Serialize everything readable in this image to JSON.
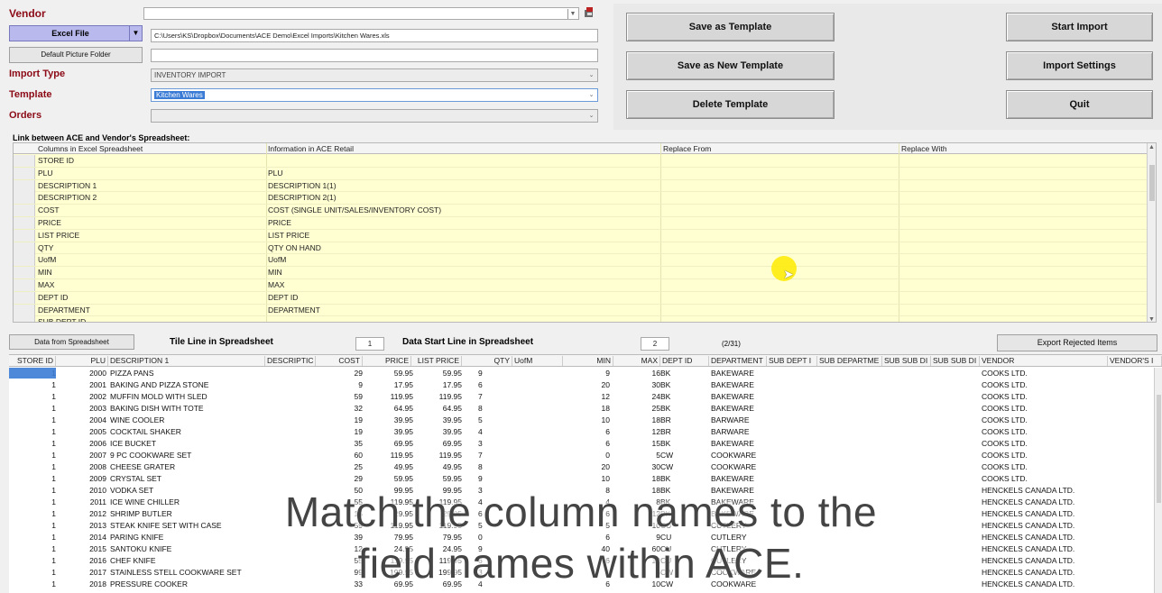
{
  "labels": {
    "vendor": "Vendor",
    "import_type": "Import Type",
    "template": "Template",
    "orders": "Orders"
  },
  "controls": {
    "excel_file": "Excel File",
    "default_picture_folder": "Default Picture Folder",
    "file_path": "C:\\Users\\KS\\Dropbox\\Documents\\ACE Demo\\Excel Imports\\Kitchen Wares.xls",
    "import_type_value": "INVENTORY IMPORT",
    "template_value": "Kitchen Wares"
  },
  "buttons": {
    "save_template": "Save as Template",
    "save_new_template": "Save as New Template",
    "delete_template": "Delete Template",
    "start_import": "Start Import",
    "import_settings": "Import Settings",
    "quit": "Quit",
    "data_from_spreadsheet": "Data from Spreadsheet",
    "export_rejected": "Export Rejected Items"
  },
  "link": {
    "title": "Link between ACE and Vendor's Spreadsheet:",
    "headers": [
      "Columns in Excel Spreadsheet",
      "Information in ACE Retail",
      "Replace From",
      "Replace With"
    ],
    "rows": [
      [
        "STORE ID",
        ""
      ],
      [
        "PLU",
        "PLU"
      ],
      [
        "DESCRIPTION 1",
        "DESCRIPTION 1(1)"
      ],
      [
        "DESCRIPTION 2",
        "DESCRIPTION 2(1)"
      ],
      [
        "COST",
        "COST (SINGLE UNIT/SALES/INVENTORY COST)"
      ],
      [
        "PRICE",
        "PRICE"
      ],
      [
        "LIST PRICE",
        "LIST PRICE"
      ],
      [
        "QTY",
        "QTY ON HAND"
      ],
      [
        "UofM",
        "UofM"
      ],
      [
        "MIN",
        "MIN"
      ],
      [
        "MAX",
        "MAX"
      ],
      [
        "DEPT ID",
        "DEPT ID"
      ],
      [
        "DEPARTMENT",
        "DEPARTMENT"
      ],
      [
        "SUB DEPT ID",
        ""
      ]
    ]
  },
  "lines": {
    "title_line_label": "Tile Line in Spreadsheet",
    "title_line_value": "1",
    "data_start_label": "Data Start Line in Spreadsheet",
    "data_start_value": "2",
    "counter": "(2/31)"
  },
  "grid": {
    "headers": [
      "STORE ID",
      "PLU",
      "DESCRIPTION 1",
      "DESCRIPTIC",
      "COST",
      "PRICE",
      "LIST PRICE",
      "QTY",
      "UofM",
      "MIN",
      "MAX",
      "DEPT ID",
      "DEPARTMENT",
      "SUB DEPT I",
      "SUB DEPARTME",
      "SUB SUB DI",
      "SUB SUB DI",
      "VENDOR",
      "VENDOR'S I"
    ],
    "rows": [
      [
        "1",
        "2000",
        "PIZZA PANS",
        "29",
        "59.95",
        "59.95",
        "9",
        "9",
        "16",
        "BK",
        "BAKEWARE",
        "COOKS LTD."
      ],
      [
        "1",
        "2001",
        "BAKING AND PIZZA STONE",
        "9",
        "17.95",
        "17.95",
        "6",
        "20",
        "30",
        "BK",
        "BAKEWARE",
        "COOKS LTD."
      ],
      [
        "1",
        "2002",
        "MUFFIN MOLD WITH SLED",
        "59",
        "119.95",
        "119.95",
        "7",
        "12",
        "24",
        "BK",
        "BAKEWARE",
        "COOKS LTD."
      ],
      [
        "1",
        "2003",
        "BAKING DISH WITH TOTE",
        "32",
        "64.95",
        "64.95",
        "8",
        "18",
        "25",
        "BK",
        "BAKEWARE",
        "COOKS LTD."
      ],
      [
        "1",
        "2004",
        "WINE COOLER",
        "19",
        "39.95",
        "39.95",
        "5",
        "10",
        "18",
        "BR",
        "BARWARE",
        "COOKS LTD."
      ],
      [
        "1",
        "2005",
        "COCKTAIL SHAKER",
        "19",
        "39.95",
        "39.95",
        "4",
        "6",
        "12",
        "BR",
        "BARWARE",
        "COOKS LTD."
      ],
      [
        "1",
        "2006",
        "ICE BUCKET",
        "35",
        "69.95",
        "69.95",
        "3",
        "6",
        "15",
        "BK",
        "BAKEWARE",
        "COOKS LTD."
      ],
      [
        "1",
        "2007",
        "9 PC COOKWARE SET",
        "60",
        "119.95",
        "119.95",
        "7",
        "0",
        "5",
        "CW",
        "COOKWARE",
        "COOKS LTD."
      ],
      [
        "1",
        "2008",
        "CHEESE GRATER",
        "25",
        "49.95",
        "49.95",
        "8",
        "20",
        "30",
        "CW",
        "COOKWARE",
        "COOKS LTD."
      ],
      [
        "1",
        "2009",
        "CRYSTAL SET",
        "29",
        "59.95",
        "59.95",
        "9",
        "10",
        "18",
        "BK",
        "BAKEWARE",
        "COOKS LTD."
      ],
      [
        "1",
        "2010",
        "VODKA SET",
        "50",
        "99.95",
        "99.95",
        "3",
        "8",
        "18",
        "BK",
        "BAKEWARE",
        "HENCKELS CANADA LTD."
      ],
      [
        "1",
        "2011",
        "ICE WINE CHILLER",
        "55",
        "119.95",
        "119.95",
        "4",
        "4",
        "8",
        "BK",
        "BAKEWARE",
        "HENCKELS CANADA LTD."
      ],
      [
        "1",
        "2012",
        "SHRIMP BUTLER",
        "15",
        "29.95",
        "29.95",
        "6",
        "6",
        "12",
        "BK",
        "BAKEWARE",
        "HENCKELS CANADA LTD."
      ],
      [
        "1",
        "2013",
        "STEAK KNIFE SET WITH CASE",
        "59",
        "119.95",
        "119.95",
        "5",
        "5",
        "10",
        "CU",
        "CUTLERY",
        "HENCKELS CANADA LTD."
      ],
      [
        "1",
        "2014",
        "PARING KNIFE",
        "39",
        "79.95",
        "79.95",
        "0",
        "6",
        "9",
        "CU",
        "CUTLERY",
        "HENCKELS CANADA LTD."
      ],
      [
        "1",
        "2015",
        "SANTOKU KNIFE",
        "12",
        "24.95",
        "24.95",
        "9",
        "40",
        "60",
        "CU",
        "CUTLERY",
        "HENCKELS CANADA LTD."
      ],
      [
        "1",
        "2016",
        "CHEF KNIFE",
        "55",
        "119.95",
        "119.95",
        "6",
        "6",
        "12",
        "CU",
        "CUTLERY",
        "HENCKELS CANADA LTD."
      ],
      [
        "1",
        "2017",
        "STAINLESS STELL COOKWARE SET",
        "99",
        "199.95",
        "199.95",
        "3",
        "3",
        "6",
        "CW",
        "COOKWARE",
        "HENCKELS CANADA LTD."
      ],
      [
        "1",
        "2018",
        "PRESSURE COOKER",
        "33",
        "69.95",
        "69.95",
        "4",
        "6",
        "10",
        "CW",
        "COOKWARE",
        "HENCKELS CANADA LTD."
      ]
    ]
  },
  "caption": {
    "line1": "Match the column names to the",
    "line2": "field names within ACE."
  },
  "icons": {
    "dropdown": "chevron-down-icon",
    "browse": "browse-icon"
  },
  "colors": {
    "label_red": "#8b0a16",
    "link_bg": "#ffffd2",
    "selection": "#3a7bd5"
  }
}
